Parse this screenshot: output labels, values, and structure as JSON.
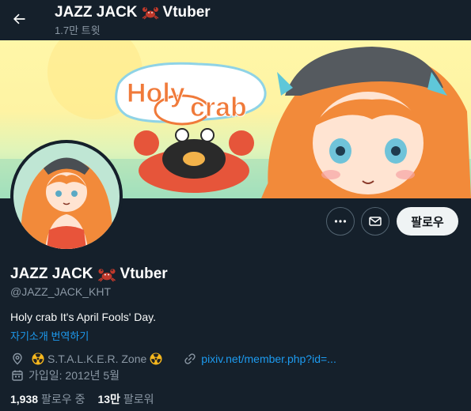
{
  "header": {
    "title": "JAZZ JACK",
    "title_suffix": "Vtuber",
    "tweet_count": "1.7만 트윗"
  },
  "banner": {
    "logo_text_1": "Holy",
    "logo_text_2": "crab"
  },
  "actions": {
    "follow_label": "팔로우"
  },
  "profile": {
    "name": "JAZZ JACK",
    "name_suffix": "Vtuber",
    "handle": "@JAZZ_JACK_KHT",
    "bio": "Holy crab It's April Fools' Day.",
    "translate": "자기소개 번역하기",
    "location": "S.T.A.L.K.E.R. Zone",
    "website": "pixiv.net/member.php?id=...",
    "joined": "가입일: 2012년 5월"
  },
  "stats": {
    "following_count": "1,938",
    "following_label": "팔로우 중",
    "followers_count": "13만",
    "followers_label": "팔로워"
  },
  "colors": {
    "background": "#15202b",
    "accent": "#1d9bf0",
    "secondary_text": "#8b98a5",
    "crab_red": "#c0392b"
  }
}
